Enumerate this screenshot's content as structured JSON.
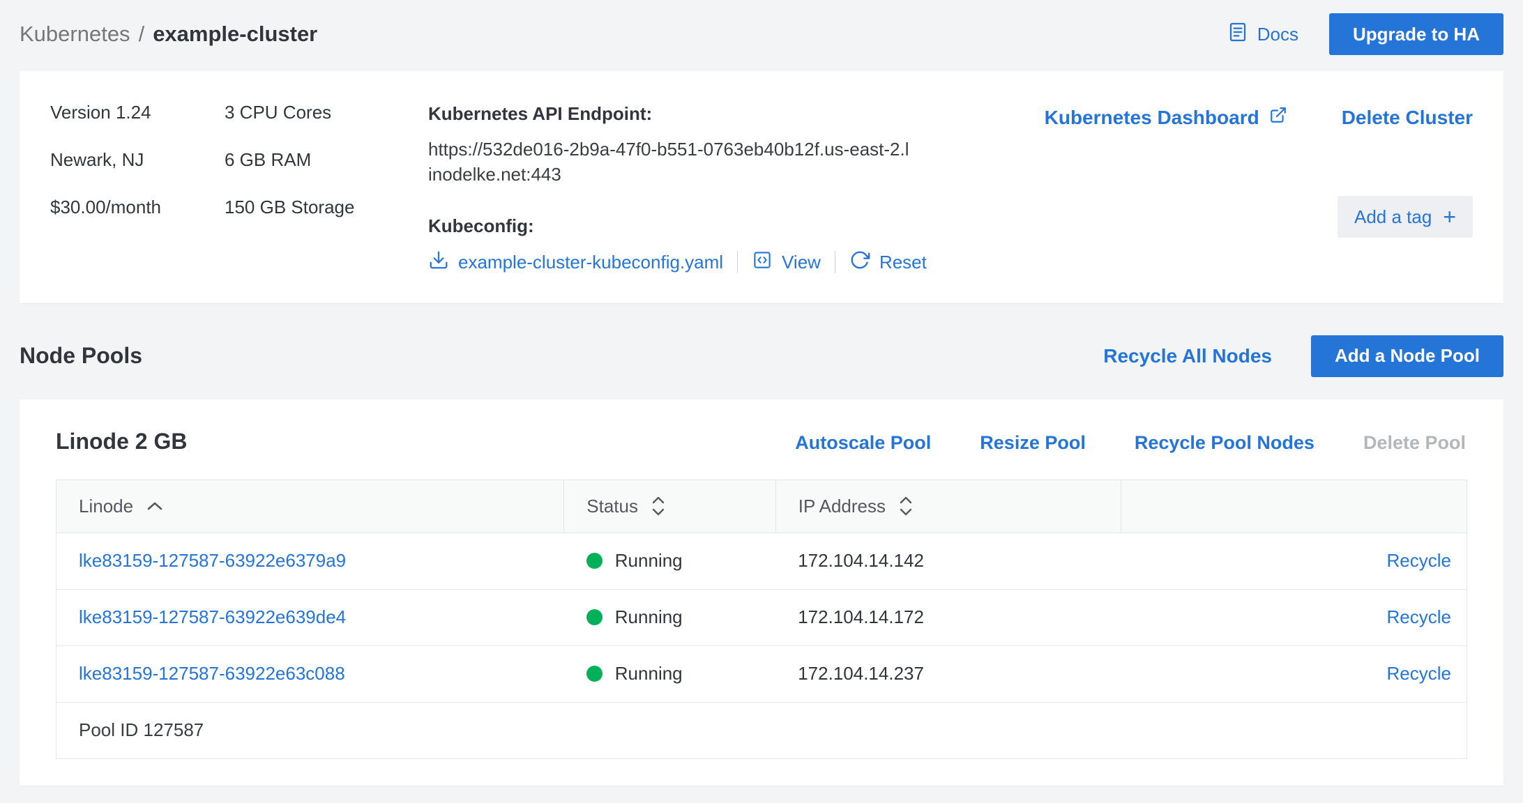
{
  "colors": {
    "accent_blue": "#2575d9",
    "running_green": "#00b159",
    "disabled_gray": "#b4b7ba",
    "page_background": "#f3f4f6"
  },
  "icons": {
    "docs": "document-with-lines",
    "external_link": "box-with-arrow-out",
    "download": "arrow-down-into-tray",
    "view": "code-brackets-in-box",
    "reset": "circular-rotate-arrow",
    "add_tag_plus": "plus-sign",
    "sort_ascending": "chevron-up",
    "sort_both": "chevron-up-and-down",
    "status": "filled-green-circle"
  },
  "header": {
    "breadcrumb_root": "Kubernetes",
    "breadcrumb_separator": "/",
    "breadcrumb_current": "example-cluster",
    "docs_label": "Docs",
    "upgrade_ha_button": "Upgrade to HA"
  },
  "summary": {
    "specs_col1": [
      "Version 1.24",
      "Newark, NJ",
      "$30.00/month"
    ],
    "specs_col2": [
      "3 CPU Cores",
      "6 GB RAM",
      "150 GB Storage"
    ],
    "api_endpoint_label": "Kubernetes API Endpoint:",
    "api_endpoint_url": "https://532de016-2b9a-47f0-b551-0763eb40b12f.us-east-2.linodelke.net:443",
    "kubeconfig_label": "Kubeconfig:",
    "kubeconfig_file_link": "example-cluster-kubeconfig.yaml",
    "view_link": "View",
    "reset_link": "Reset",
    "dashboard_link": "Kubernetes Dashboard",
    "delete_cluster_link": "Delete Cluster",
    "add_tag_label": "Add a tag",
    "add_tag_plus": "+"
  },
  "node_pools": {
    "section_title": "Node Pools",
    "recycle_all_link": "Recycle All Nodes",
    "add_pool_button": "Add a Node Pool"
  },
  "pool": {
    "title": "Linode 2 GB",
    "actions": [
      "Autoscale Pool",
      "Resize Pool",
      "Recycle Pool Nodes",
      "Delete Pool"
    ],
    "columns": [
      "Linode",
      "Status",
      "IP Address"
    ],
    "rows": [
      {
        "linode": "lke83159-127587-63922e6379a9",
        "status": "Running",
        "ip": "172.104.14.142",
        "action": "Recycle"
      },
      {
        "linode": "lke83159-127587-63922e639de4",
        "status": "Running",
        "ip": "172.104.14.172",
        "action": "Recycle"
      },
      {
        "linode": "lke83159-127587-63922e63c088",
        "status": "Running",
        "ip": "172.104.14.237",
        "action": "Recycle"
      }
    ],
    "footer": "Pool ID 127587"
  }
}
